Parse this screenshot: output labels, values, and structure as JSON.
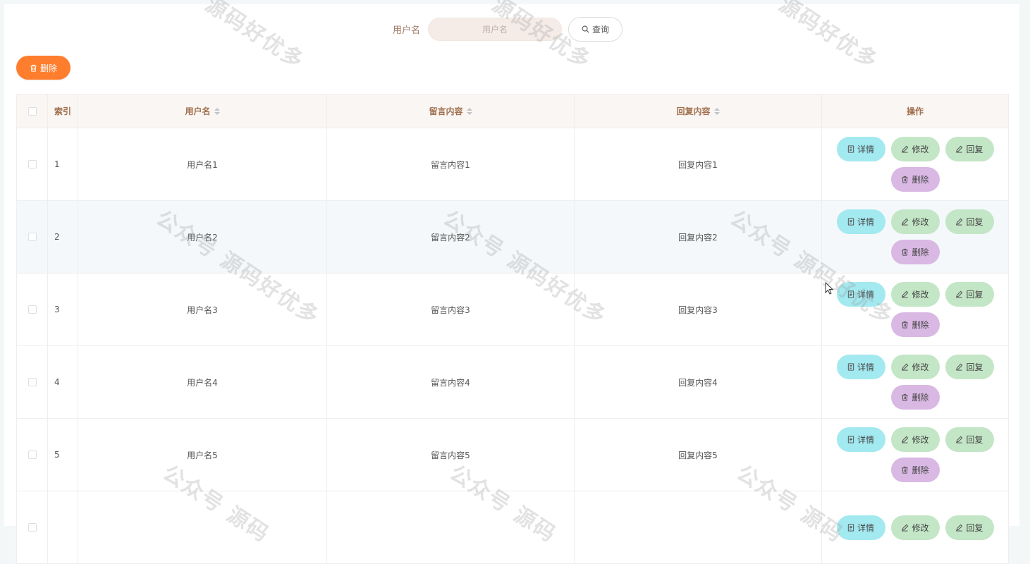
{
  "search": {
    "label": "用户名",
    "placeholder": "用户名",
    "button_label": "查询"
  },
  "toolbar": {
    "delete_label": "删除"
  },
  "table": {
    "columns": [
      "索引",
      "用户名",
      "留言内容",
      "回复内容",
      "操作"
    ],
    "rows": [
      {
        "index": "1",
        "username": "用户名1",
        "message": "留言内容1",
        "reply": "回复内容1"
      },
      {
        "index": "2",
        "username": "用户名2",
        "message": "留言内容2",
        "reply": "回复内容2"
      },
      {
        "index": "3",
        "username": "用户名3",
        "message": "留言内容3",
        "reply": "回复内容3"
      },
      {
        "index": "4",
        "username": "用户名4",
        "message": "留言内容4",
        "reply": "回复内容4"
      },
      {
        "index": "5",
        "username": "用户名5",
        "message": "留言内容5",
        "reply": "回复内容5"
      },
      {
        "index": "",
        "username": "",
        "message": "",
        "reply": ""
      }
    ],
    "actions": {
      "detail": "详情",
      "edit": "修改",
      "reply": "回复",
      "delete": "删除"
    }
  },
  "watermark": {
    "text": "公众号 源码好优多",
    "partial_top": "源码好优多",
    "partial_bottom": "公众号 源码"
  },
  "colors": {
    "accent": "#ff7e2e",
    "detail": "#a3e9f0",
    "edit": "#c3e6c6",
    "delete": "#d9b8e4",
    "header_text": "#a0704f"
  }
}
